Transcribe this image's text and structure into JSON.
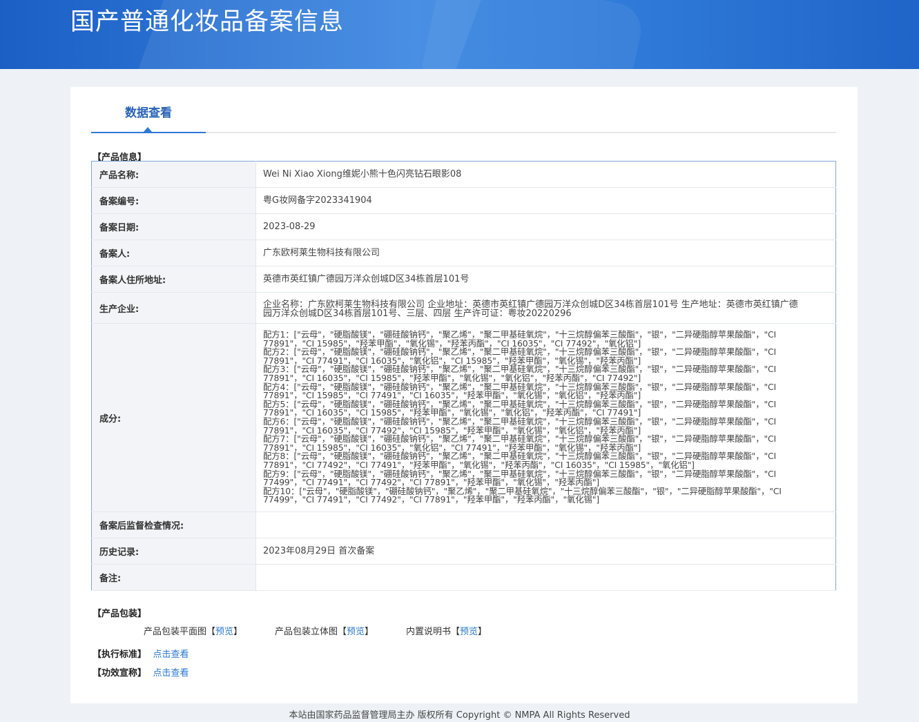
{
  "header": {
    "title": "国产普通化妆品备案信息"
  },
  "tab": {
    "label": "数据查看"
  },
  "sections": {
    "product_info": "【产品信息】",
    "packaging": "【产品包装】",
    "standard": "【执行标准】",
    "efficacy": "【功效宣称】"
  },
  "info": {
    "name_k": "产品名称:",
    "name_v": "Wei Ni Xiao Xiong维妮小熊十色闪亮钻石眼影08",
    "reg_no_k": "备案编号:",
    "reg_no_v": "粤G妆网备字2023341904",
    "date_k": "备案日期:",
    "date_v": "2023-08-29",
    "filer_k": "备案人:",
    "filer_v": "广东欧柯莱生物科技有限公司",
    "address_k": "备案人住所地址:",
    "address_v": "英德市英红镇广德园万洋众创城D区34栋首层101号",
    "maker_k": "生产企业:",
    "maker_v": "企业名称：广东欧柯莱生物科技有限公司 企业地址：英德市英红镇广德园万洋众创城D区34栋首层101号 生产地址：英德市英红镇广德园万洋众创城D区34栋首层101号、三层、四层 生产许可证：粤妆20220296",
    "ingredients_k": "成分:",
    "ingredients": [
      "配方1：[\"云母\"，\"硬脂酸镁\"，\"硼硅酸钠钙\"，\"聚乙烯\"，\"聚二甲基硅氧烷\"，\"十三烷醇偏苯三酸酯\"，\"银\"，\"二异硬脂醇苹果酸酯\"，\"CI 77891\"，\"CI 15985\"，\"羟苯甲酯\"，\"氧化锡\"，\"羟苯丙酯\"，\"CI 16035\"，\"CI 77492\"，\"氧化铝\"]",
      "配方2：[\"云母\"，\"硬脂酸镁\"，\"硼硅酸钠钙\"，\"聚乙烯\"，\"聚二甲基硅氧烷\"，\"十三烷醇偏苯三酸酯\"，\"银\"，\"二异硬脂醇苹果酸酯\"，\"CI 77891\"，\"CI 77491\"，\"CI 16035\"，\"氧化铝\"，\"CI 15985\"，\"羟苯甲酯\"，\"氧化锡\"，\"羟苯丙酯\"]",
      "配方3：[\"云母\"，\"硬脂酸镁\"，\"硼硅酸钠钙\"，\"聚乙烯\"，\"聚二甲基硅氧烷\"，\"十三烷醇偏苯三酸酯\"，\"银\"，\"二异硬脂醇苹果酸酯\"，\"CI 77891\"，\"CI 16035\"，\"CI 15985\"，\"羟苯甲酯\"，\"氧化锡\"，\"氧化铝\"，\"羟苯丙酯\"，\"CI 77492\"]",
      "配方4：[\"云母\"，\"硬脂酸镁\"，\"硼硅酸钠钙\"，\"聚乙烯\"，\"聚二甲基硅氧烷\"，\"十三烷醇偏苯三酸酯\"，\"银\"，\"二异硬脂醇苹果酸酯\"，\"CI 77891\"，\"CI 15985\"，\"CI 77491\"，\"CI 16035\"，\"羟苯甲酯\"，\"氧化锡\"，\"氧化铝\"，\"羟苯丙酯\"]",
      "配方5：[\"云母\"，\"硬脂酸镁\"，\"硼硅酸钠钙\"，\"聚乙烯\"，\"聚二甲基硅氧烷\"，\"十三烷醇偏苯三酸酯\"，\"银\"，\"二异硬脂醇苹果酸酯\"，\"CI 77891\"，\"CI 16035\"，\"CI 15985\"，\"羟苯甲酯\"，\"氧化锡\"，\"氧化铝\"，\"羟苯丙酯\"，\"CI 77491\"]",
      "配方6：[\"云母\"，\"硬脂酸镁\"，\"硼硅酸钠钙\"，\"聚乙烯\"，\"聚二甲基硅氧烷\"，\"十三烷醇偏苯三酸酯\"，\"银\"，\"二异硬脂醇苹果酸酯\"，\"CI 77891\"，\"CI 16035\"，\"CI 77492\"，\"CI 15985\"，\"羟苯甲酯\"，\"氧化锡\"，\"氧化铝\"，\"羟苯丙酯\"]",
      "配方7：[\"云母\"，\"硬脂酸镁\"，\"硼硅酸钠钙\"，\"聚乙烯\"，\"聚二甲基硅氧烷\"，\"十三烷醇偏苯三酸酯\"，\"银\"，\"二异硬脂醇苹果酸酯\"，\"CI 77891\"，\"CI 15985\"，\"CI 16035\"，\"氧化铝\"，\"CI 77491\"，\"羟苯甲酯\"，\"氧化锡\"，\"羟苯丙酯\"]",
      "配方8：[\"云母\"，\"硬脂酸镁\"，\"硼硅酸钠钙\"，\"聚乙烯\"，\"聚二甲基硅氧烷\"，\"十三烷醇偏苯三酸酯\"，\"银\"，\"二异硬脂醇苹果酸酯\"，\"CI 77891\"，\"CI 77492\"，\"CI 77491\"，\"羟苯甲酯\"，\"氧化锡\"，\"羟苯丙酯\"，\"CI 16035\"，\"CI 15985\"，\"氧化铝\"]",
      "配方9：[\"云母\"，\"硬脂酸镁\"，\"硼硅酸钠钙\"，\"聚乙烯\"，\"聚二甲基硅氧烷\"，\"十三烷醇偏苯三酸酯\"，\"银\"，\"二异硬脂醇苹果酸酯\"，\"CI 77499\"，\"CI 77491\"，\"CI 77492\"，\"CI 77891\"，\"羟苯甲酯\"，\"氧化锡\"，\"羟苯丙酯\"]",
      "配方10：[\"云母\"，\"硬脂酸镁\"，\"硼硅酸钠钙\"，\"聚乙烯\"，\"聚二甲基硅氧烷\"，\"十三烷醇偏苯三酸酯\"，\"银\"，\"二异硬脂醇苹果酸酯\"，\"CI 77499\"，\"CI 77491\"，\"CI 77492\"，\"CI 77891\"，\"羟苯甲酯\"，\"羟苯丙酯\"，\"氧化锡\"]"
    ],
    "inspection_k": "备案后监督检查情况:",
    "inspection_v": "",
    "history_k": "历史记录:",
    "history_v": "2023年08月29日 首次备案",
    "remark_k": "备注:",
    "remark_v": ""
  },
  "packaging": {
    "flat_label": "产品包装平面图",
    "solid_label": "产品包装立体图",
    "manual_label": "内置说明书",
    "bracket_open": "【",
    "bracket_close": "】",
    "preview": "预览"
  },
  "links": {
    "view": "点击查看"
  },
  "footer": {
    "text": "本站由国家药品监督管理局主办 版权所有 Copyright © NMPA All Rights Reserved"
  }
}
